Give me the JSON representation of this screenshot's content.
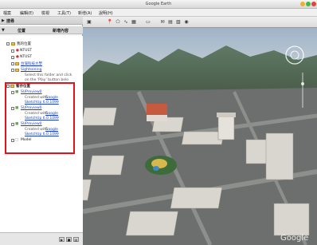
{
  "window": {
    "title": "Google Earth"
  },
  "menu": [
    "檔案",
    "編輯(E)",
    "檢視",
    "工具(T)",
    "新增(A)",
    "說明(H)"
  ],
  "sidebar": {
    "search_label": "搜尋",
    "places_label": "位置",
    "add_content_label": "新增內容",
    "items": [
      {
        "label": "我的位置",
        "type": "folder"
      },
      {
        "label": "NTUST",
        "type": "placemark"
      },
      {
        "label": "NTUST",
        "type": "placemark"
      },
      {
        "label": "台灣科技大學",
        "type": "link"
      },
      {
        "label": "Sightseeing",
        "type": "link"
      },
      {
        "label": "Select this folder and click",
        "type": "desc"
      },
      {
        "label": "on the 'Play' button belo",
        "type": "desc"
      },
      {
        "label": "暫存位置",
        "type": "folder"
      },
      {
        "label": "SUPreview0",
        "type": "link"
      },
      {
        "label": "Created with",
        "type": "desc-link",
        "link": "Google"
      },
      {
        "label": "SketchUp 6.0.1099",
        "type": "link"
      },
      {
        "label": "SUPreview0",
        "type": "link"
      },
      {
        "label": "Created with",
        "type": "desc-link",
        "link": "Google"
      },
      {
        "label": "SketchUp 6.0.1099",
        "type": "link"
      },
      {
        "label": "SUPreview0",
        "type": "link"
      },
      {
        "label": "Created with",
        "type": "desc-link",
        "link": "Google"
      },
      {
        "label": "SketchUp 6.0.1099",
        "type": "link"
      },
      {
        "label": "Model",
        "type": "model"
      }
    ]
  },
  "map": {
    "watermark": "Google"
  },
  "colors": {
    "highlight": "#e0141a",
    "link": "#1a3fcf",
    "close": "#e0443a",
    "minimize": "#f1b032",
    "zoom": "#48b548"
  },
  "icons": [
    "pointer-icon",
    "placemark-icon",
    "polygon-icon",
    "path-icon",
    "overlay-icon",
    "tour-icon",
    "email-icon",
    "print-icon",
    "kml-icon",
    "maps-icon"
  ]
}
